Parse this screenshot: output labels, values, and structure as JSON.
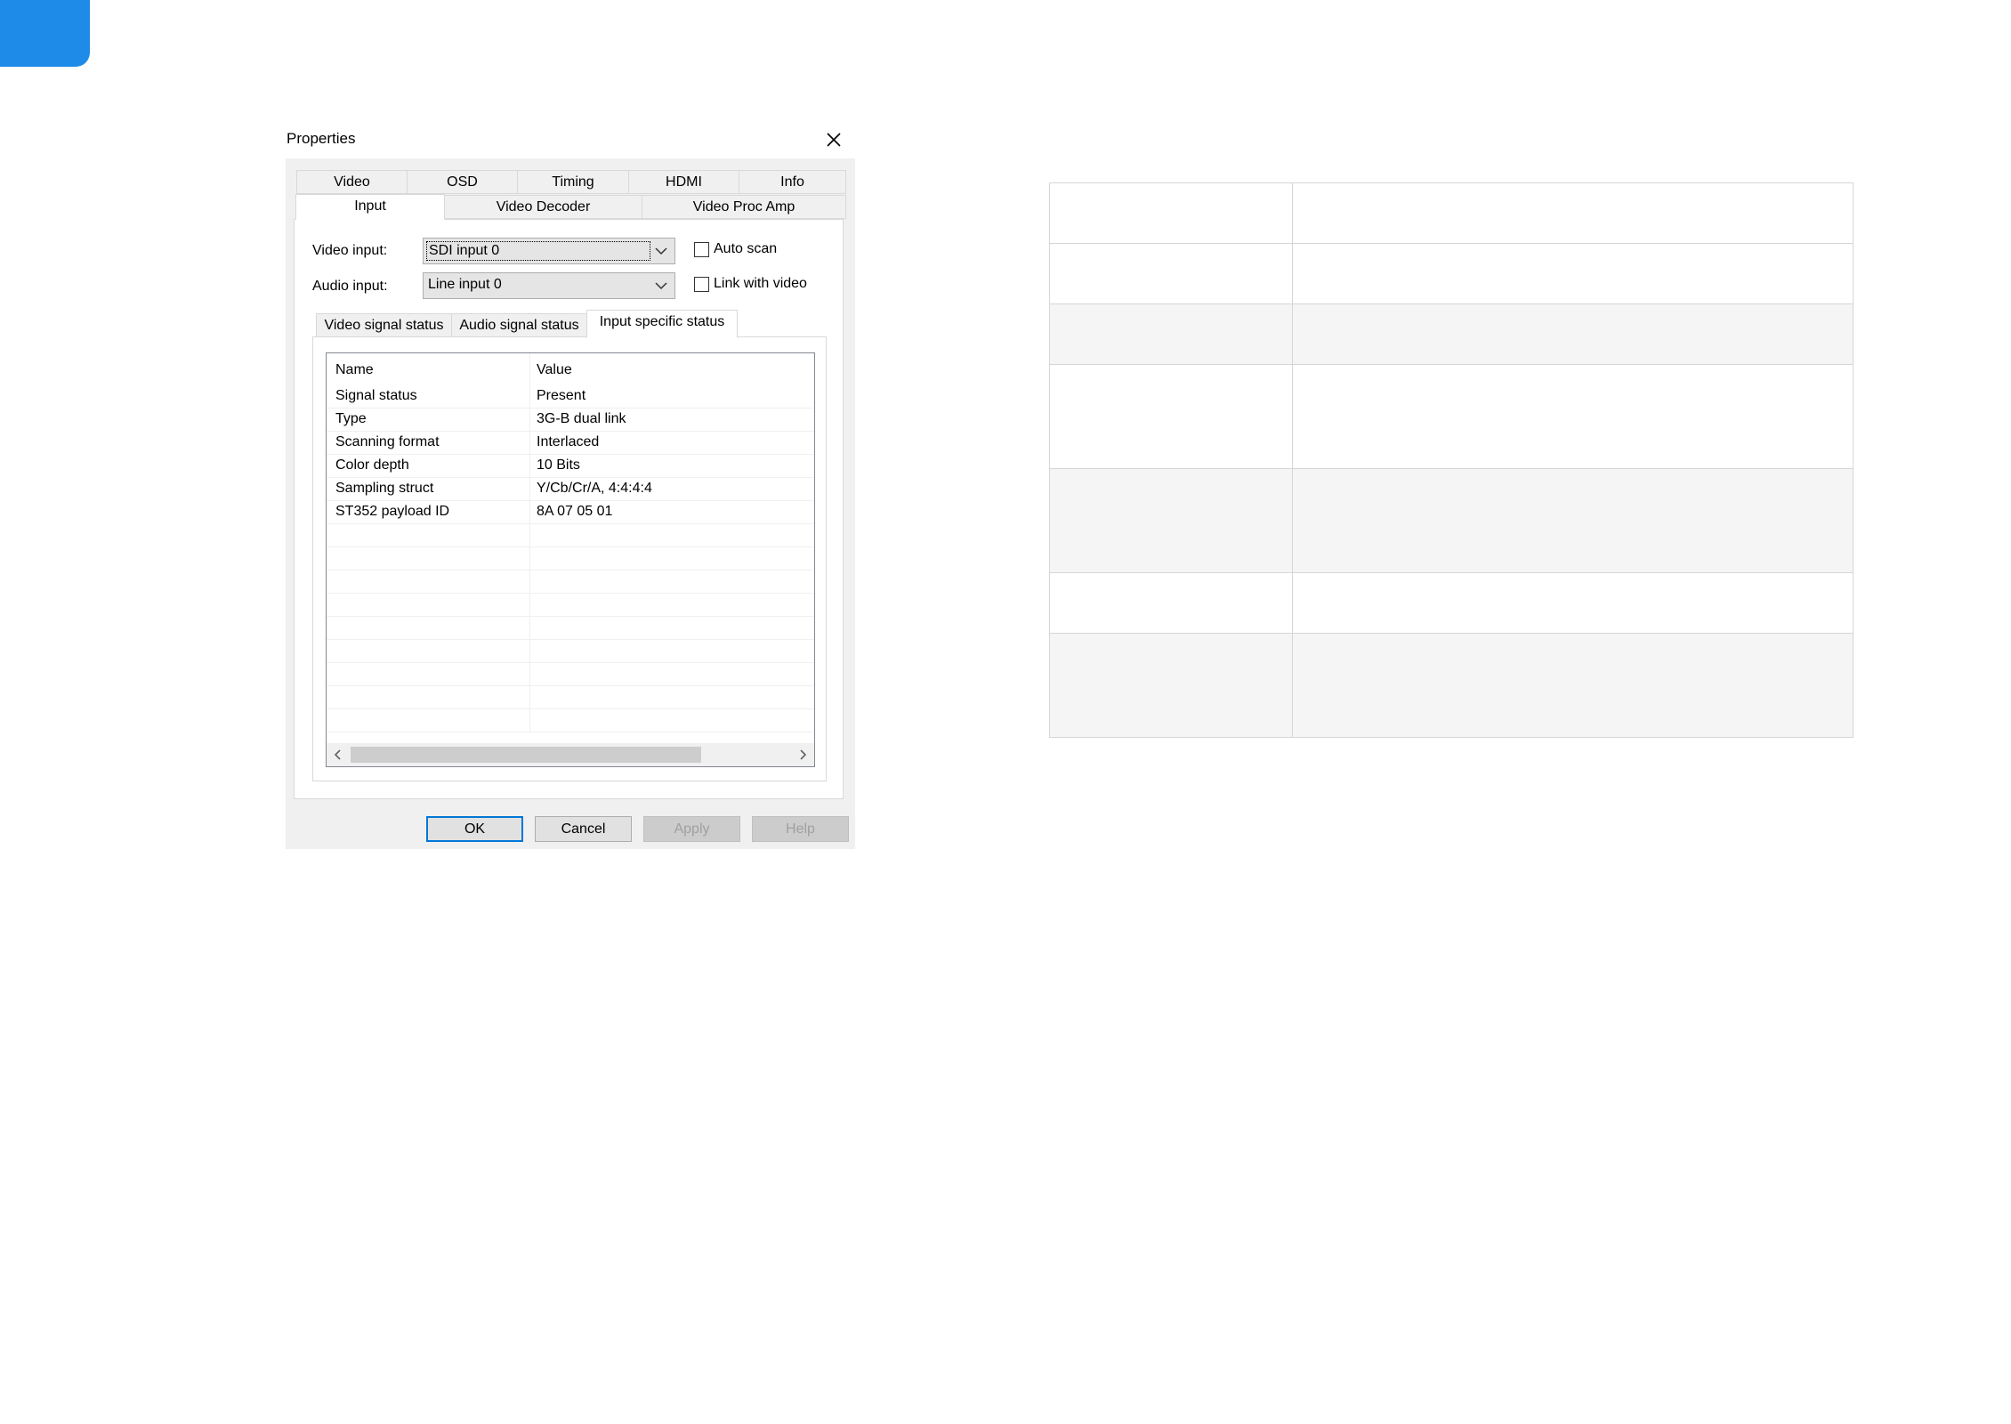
{
  "dialog": {
    "title": "Properties",
    "main_tabs_row1": [
      "Video",
      "OSD",
      "Timing",
      "HDMI",
      "Info"
    ],
    "main_tabs_row2": [
      "Input",
      "Video Decoder",
      "Video Proc Amp"
    ],
    "active_tab": "Input",
    "video_input": {
      "label": "Video input:",
      "value": "SDI input 0"
    },
    "audio_input": {
      "label": "Audio input:",
      "value": "Line input 0"
    },
    "auto_scan": {
      "label": "Auto scan",
      "checked": false
    },
    "link_with_video": {
      "label": "Link with video",
      "checked": false
    },
    "sub_tabs": [
      "Video signal status",
      "Audio signal status",
      "Input specific status"
    ],
    "active_sub_tab": "Input specific status",
    "list": {
      "columns": [
        "Name",
        "Value"
      ],
      "rows": [
        {
          "name": "Signal status",
          "value": "Present"
        },
        {
          "name": "Type",
          "value": "3G-B dual link"
        },
        {
          "name": "Scanning format",
          "value": "Interlaced"
        },
        {
          "name": "Color depth",
          "value": "10 Bits"
        },
        {
          "name": "Sampling struct",
          "value": "Y/Cb/Cr/A, 4:4:4:4"
        },
        {
          "name": "ST352 payload ID",
          "value": "8A 07 05 01"
        }
      ]
    },
    "buttons": {
      "ok": "OK",
      "cancel": "Cancel",
      "apply": "Apply",
      "help": "Help"
    }
  },
  "colors": {
    "accent": "#1e8be8",
    "focus_border": "#0078d7"
  },
  "icons": {
    "close": "close-icon",
    "dropdown": "chevron-down-icon",
    "scroll_left": "chevron-left-icon",
    "scroll_right": "chevron-right-icon"
  }
}
